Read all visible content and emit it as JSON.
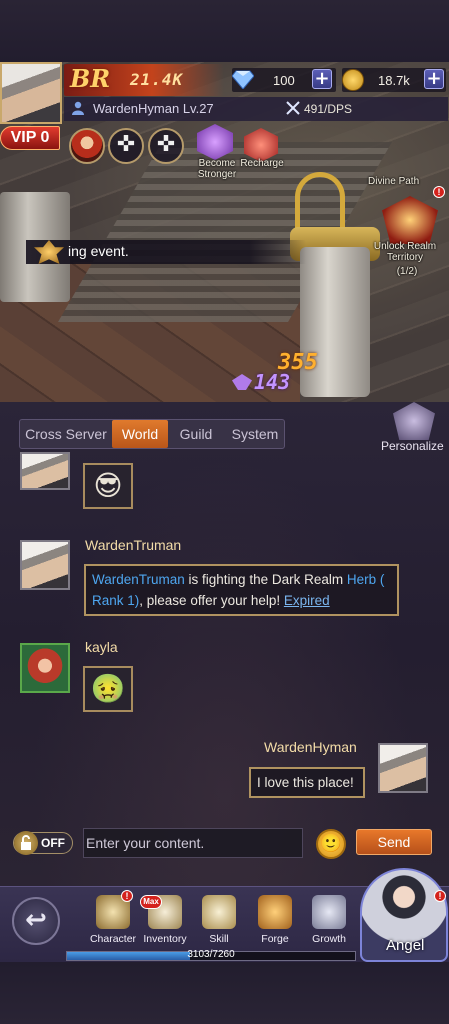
{
  "header": {
    "br_label": "BR",
    "power": "21.4K",
    "gems": "100",
    "gold": "18.7k",
    "player_name": "WardenHyman Lv.27",
    "dps": "491/DPS"
  },
  "shortcuts": {
    "vip": "VIP 0",
    "become_stronger": "Become Stronger",
    "recharge": "Recharge",
    "divine_path": "Divine Path",
    "unlock_realm": "Unlock Realm Territory",
    "realm_progress": "(1/2)"
  },
  "event_banner": "ing event.",
  "scene_numbers": {
    "gold_gain": "355",
    "wing_gain": "143"
  },
  "tabs": [
    {
      "label": "Cross Server"
    },
    {
      "label": "World"
    },
    {
      "label": "Guild"
    },
    {
      "label": "System"
    }
  ],
  "active_tab": "World",
  "personalize": "Personalize",
  "messages": [
    {
      "sender": "",
      "emoji": "😎"
    },
    {
      "sender": "WardenTruman",
      "text_name": "WardenTruman",
      "text_mid": " is fighting the Dark Realm ",
      "text_boss": "Herb ( Rank 1)",
      "text_tail": ", please offer your help! ",
      "text_status": "Expired"
    },
    {
      "sender": "kayla",
      "emoji": "🤢"
    },
    {
      "sender": "WardenHyman",
      "text": "I love this place!"
    }
  ],
  "input": {
    "lock_state": "OFF",
    "placeholder": "Enter your content.",
    "send_label": "Send"
  },
  "nav": [
    {
      "label": "Character"
    },
    {
      "label": "Inventory",
      "badge": "Max"
    },
    {
      "label": "Skill"
    },
    {
      "label": "Forge"
    },
    {
      "label": "Growth"
    }
  ],
  "angel_label": "Angel",
  "exp": {
    "text": "3103/7260",
    "current": 3103,
    "max": 7260
  },
  "badge_mark": "!",
  "colors": {
    "accent_orange": "#e07a2d",
    "link_blue": "#4ea6ef",
    "gold_border": "#b09360"
  }
}
